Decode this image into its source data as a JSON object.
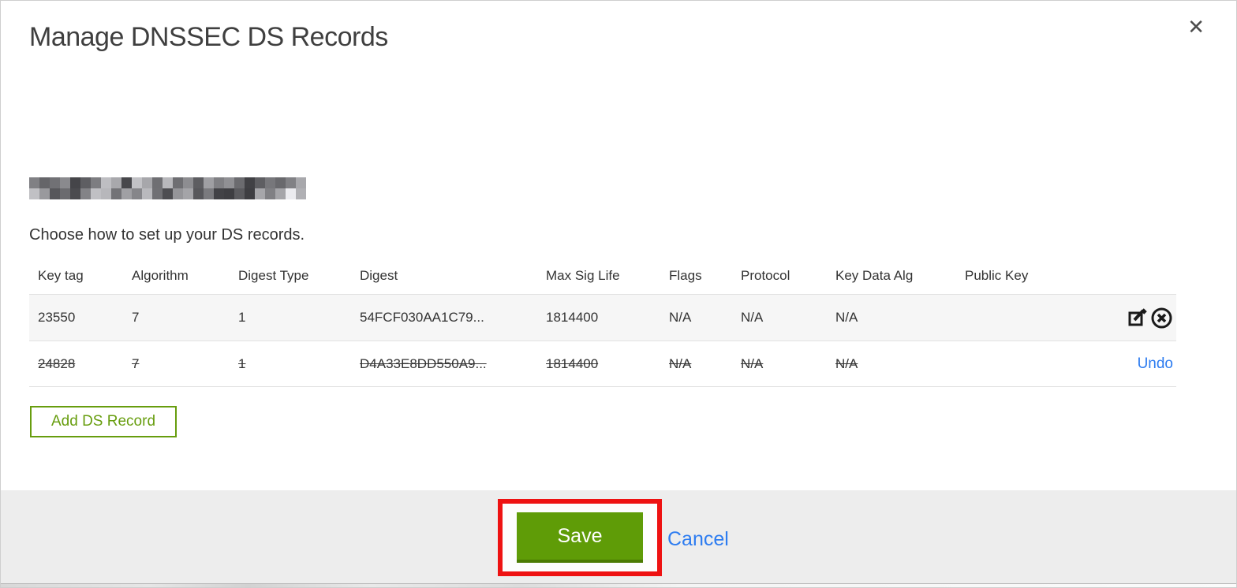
{
  "modal": {
    "title": "Manage DNSSEC DS Records",
    "close_icon": "close-icon",
    "close_glyph": "✕",
    "domain": {
      "redacted": true
    },
    "subtitle": "Choose how to set up your DS records.",
    "table": {
      "columns": [
        "Key tag",
        "Algorithm",
        "Digest Type",
        "Digest",
        "Max Sig Life",
        "Flags",
        "Protocol",
        "Key Data Alg",
        "Public Key",
        ""
      ],
      "rows": [
        {
          "key_tag": "23550",
          "algorithm": "7",
          "digest_type": "1",
          "digest": "54FCF030AA1C79...",
          "max_sig_life": "1814400",
          "flags": "N/A",
          "protocol": "N/A",
          "key_data_alg": "N/A",
          "public_key": "",
          "state": "normal",
          "actions": [
            "edit-icon",
            "delete-icon"
          ]
        },
        {
          "key_tag": "24828",
          "algorithm": "7",
          "digest_type": "1",
          "digest": "D4A33E8DD550A9...",
          "max_sig_life": "1814400",
          "flags": "N/A",
          "protocol": "N/A",
          "key_data_alg": "N/A",
          "public_key": "",
          "state": "deleted",
          "actions": [
            "undo"
          ],
          "undo_label": "Undo"
        }
      ]
    },
    "add_button_label": "Add DS Record",
    "footer": {
      "save_label": "Save",
      "cancel_label": "Cancel",
      "annotation": "red-highlight-around-save"
    }
  },
  "colors": {
    "accent_green": "#679d0e",
    "save_green": "#5f9c07",
    "save_green_dark": "#4b7b03",
    "link_blue": "#2d7cf0",
    "annotation_red": "#ee1212",
    "text_dark": "#333333",
    "row_stripe": "#f6f6f6",
    "footer_gray": "#ededed"
  }
}
